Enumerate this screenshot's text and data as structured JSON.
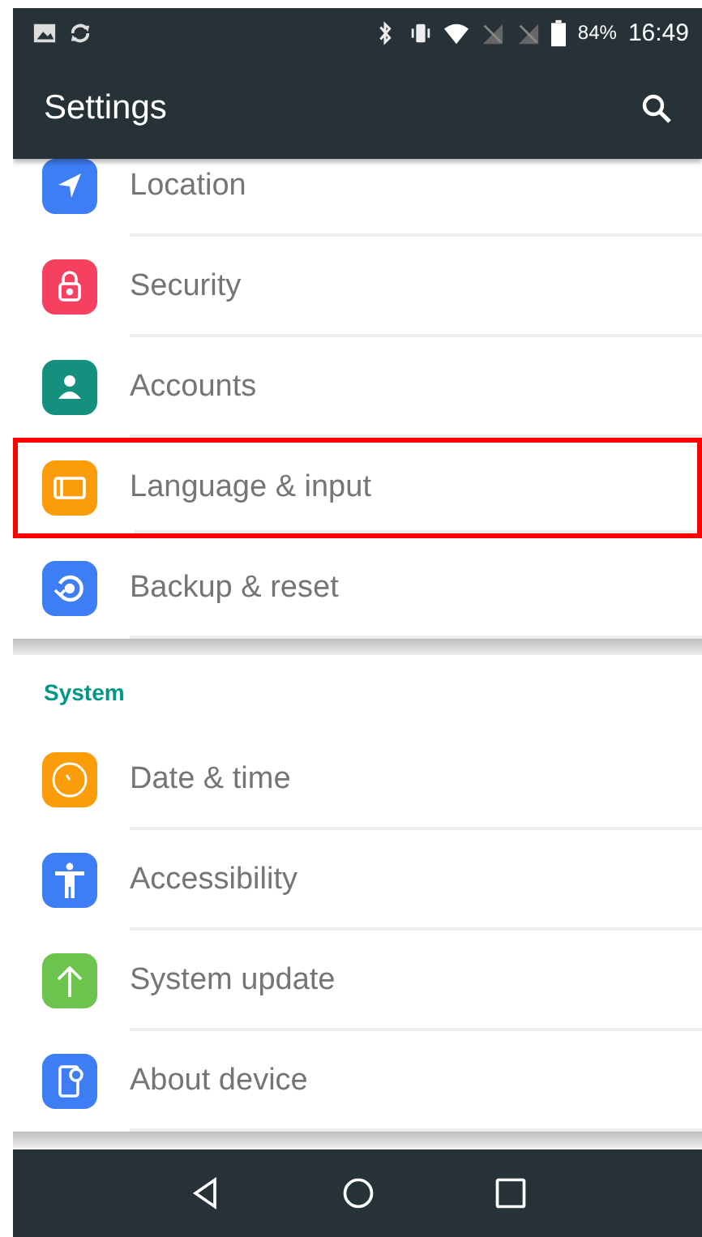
{
  "status_bar": {
    "battery": "84%",
    "time": "16:49"
  },
  "app_bar": {
    "title": "Settings"
  },
  "sections": [
    {
      "items": [
        {
          "label": "Location",
          "kind": "location",
          "color": "#3d7ef5",
          "highlighted": false
        },
        {
          "label": "Security",
          "kind": "lock",
          "color": "#f5415f",
          "highlighted": false
        },
        {
          "label": "Accounts",
          "kind": "person",
          "color": "#14917e",
          "highlighted": false
        },
        {
          "label": "Language & input",
          "kind": "keyboard",
          "color": "#fb9c0b",
          "highlighted": true
        },
        {
          "label": "Backup & reset",
          "kind": "backup",
          "color": "#3d7ef5",
          "highlighted": false
        }
      ]
    },
    {
      "header": "System",
      "items": [
        {
          "label": "Date & time",
          "kind": "clock",
          "color": "#fb9c0b",
          "highlighted": false
        },
        {
          "label": "Accessibility",
          "kind": "accessibility",
          "color": "#3d7ef5",
          "highlighted": false
        },
        {
          "label": "System update",
          "kind": "update",
          "color": "#6cc44f",
          "highlighted": false
        },
        {
          "label": "About device",
          "kind": "phone",
          "color": "#3d7ef5",
          "highlighted": false
        }
      ]
    }
  ]
}
